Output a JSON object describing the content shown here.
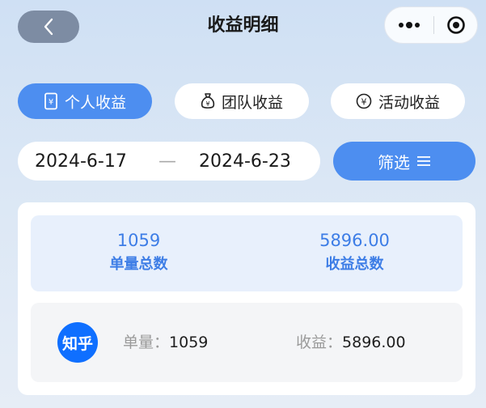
{
  "header": {
    "title": "收益明细",
    "back_icon": "chevron-left-icon",
    "more_icon": "more-dots-icon",
    "close_icon": "target-circle-icon"
  },
  "tabs": [
    {
      "label": "个人收益",
      "icon": "receipt-icon",
      "active": true
    },
    {
      "label": "团队收益",
      "icon": "money-bag-icon",
      "active": false
    },
    {
      "label": "活动收益",
      "icon": "yen-circle-icon",
      "active": false
    }
  ],
  "date_range": {
    "start": "2024-6-17",
    "separator": "—",
    "end": "2024-6-23"
  },
  "filter": {
    "label": "筛选",
    "icon": "menu-lines-icon"
  },
  "summary": {
    "orders_value": "1059",
    "orders_label": "单量总数",
    "income_value": "5896.00",
    "income_label": "收益总数"
  },
  "platform": {
    "logo_text": "知乎",
    "orders_key": "单量：",
    "orders_value": "1059",
    "income_key": "收益：",
    "income_value": "5896.00"
  },
  "colors": {
    "accent": "#4d8ef0",
    "stat_text": "#3d7de6",
    "logo_bg": "#0f6fff"
  }
}
